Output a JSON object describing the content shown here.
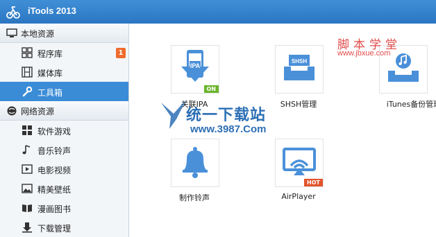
{
  "window": {
    "title": "iTools 2013"
  },
  "sidebar": {
    "local": {
      "label": "本地资源",
      "items": [
        {
          "label": "程序库",
          "badge": "1",
          "icon": "grid-icon"
        },
        {
          "label": "媒体库",
          "icon": "film-icon"
        },
        {
          "label": "工具箱",
          "icon": "wrench-icon",
          "active": true
        }
      ]
    },
    "network": {
      "label": "网络资源",
      "items": [
        {
          "label": "软件游戏",
          "icon": "grid-icon"
        },
        {
          "label": "音乐铃声",
          "icon": "music-note-icon"
        },
        {
          "label": "电影视频",
          "icon": "video-icon"
        },
        {
          "label": "精美壁纸",
          "icon": "picture-icon"
        },
        {
          "label": "漫画图书",
          "icon": "book-icon"
        },
        {
          "label": "下载管理",
          "icon": "download-icon"
        }
      ]
    }
  },
  "tools": [
    {
      "label": "关联IPA",
      "icon_text": "IPA",
      "tag": "ON",
      "tag_color": "#6cb52c"
    },
    {
      "label": "SHSH管理",
      "icon_text": "SHSH"
    },
    {
      "label": "iTunes备份管理",
      "icon_text": ""
    },
    {
      "label": "制作铃声",
      "icon_text": ""
    },
    {
      "label": "AirPlayer",
      "icon_text": "",
      "tag": "HOT",
      "tag_color": "#e2542b"
    }
  ],
  "watermarks": {
    "top_title": "脚本学堂",
    "top_url": "www.jbxue.com",
    "main_title": "统一下载站",
    "main_url": "www.3987.Com"
  },
  "colors": {
    "accent": "#3b8cd7",
    "icon_blue": "#4a90d9",
    "badge": "#ef6b2e"
  }
}
